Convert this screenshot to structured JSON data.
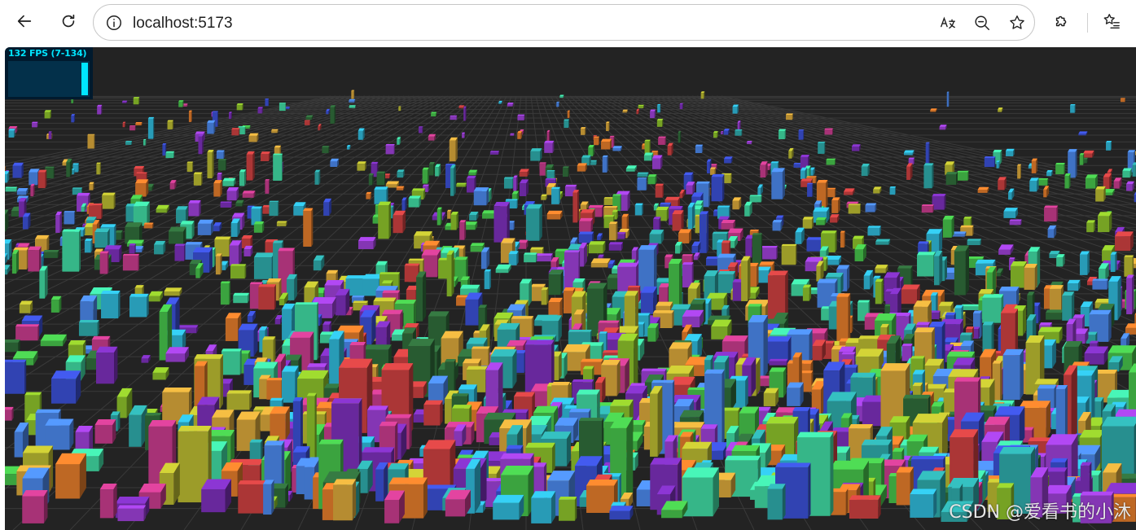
{
  "browser": {
    "url": "localhost:5173",
    "back_icon": "back-arrow-icon",
    "reload_icon": "reload-icon",
    "site_info_icon": "info-icon",
    "translate_icon": "translate-icon",
    "zoom_icon": "zoom-out-icon",
    "favorite_icon": "star-icon",
    "extensions_icon": "puzzle-icon",
    "favorites_icon": "favorites-list-icon"
  },
  "stats": {
    "fps_label": "132 FPS (7-134)",
    "color": "#00e5ff"
  },
  "scene": {
    "background": "#232323",
    "grid_color": "#3a3a3a",
    "palette": [
      "#2ea8a8",
      "#3a4fd1",
      "#c53b8b",
      "#45c04a",
      "#e07a2a",
      "#9b3fd4",
      "#2fb6d6",
      "#c94040",
      "#8bbf2a",
      "#4a86e8",
      "#d6a53a",
      "#2f6b3a",
      "#7a2fb8",
      "#3fd6a0",
      "#b8b830"
    ]
  },
  "watermark": {
    "text": "CSDN @爱看书的小沐"
  }
}
